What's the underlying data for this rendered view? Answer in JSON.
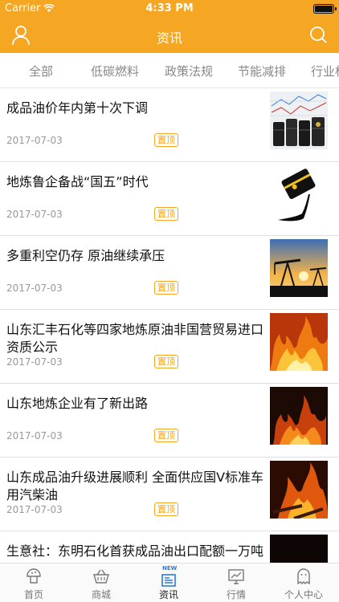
{
  "status_bar": {
    "carrier": "Carrier",
    "time": "4:33 PM"
  },
  "nav": {
    "title": "资讯"
  },
  "categories": [
    "全部",
    "低碳燃料",
    "政策法规",
    "节能减排",
    "行业标"
  ],
  "pin_label": "置顶",
  "news": [
    {
      "title": "成品油价年内第十次下调",
      "date": "2017-07-03",
      "image": "oil-barrels-chart"
    },
    {
      "title": "地炼鲁企备战“国五”时代",
      "date": "2017-07-03",
      "image": "oil-barrel-spill"
    },
    {
      "title": "多重利空仍存 原油继续承压",
      "date": "2017-07-03",
      "image": "oil-pumpjack-sunset"
    },
    {
      "title": "山东汇丰石化等四家地炼原油非国营贸易进口资质公示",
      "date": "2017-07-03",
      "image": "fire-flames"
    },
    {
      "title": "山东地炼企业有了新出路",
      "date": "2017-07-03",
      "image": "fire-flames-dark"
    },
    {
      "title": "山东成品油升级进展顺利 全面供应国Ⅴ标准车用汽柴油",
      "date": "2017-07-03",
      "image": "fire-flames-wood"
    },
    {
      "title": "生意社：东明石化首获成品油出口配额一万吨",
      "date": "",
      "image": "fire-dark"
    }
  ],
  "tab_bar": {
    "items": [
      {
        "label": "首页",
        "icon": "mushroom-home-icon",
        "active": false
      },
      {
        "label": "商城",
        "icon": "basket-icon",
        "active": false
      },
      {
        "label": "资讯",
        "icon": "news-icon",
        "active": true,
        "badge": "NEW"
      },
      {
        "label": "行情",
        "icon": "monitor-chart-icon",
        "active": false
      },
      {
        "label": "个人中心",
        "icon": "ghost-user-icon",
        "active": false
      }
    ]
  },
  "colors": {
    "accent": "#f5a623",
    "text_muted": "#999999"
  }
}
